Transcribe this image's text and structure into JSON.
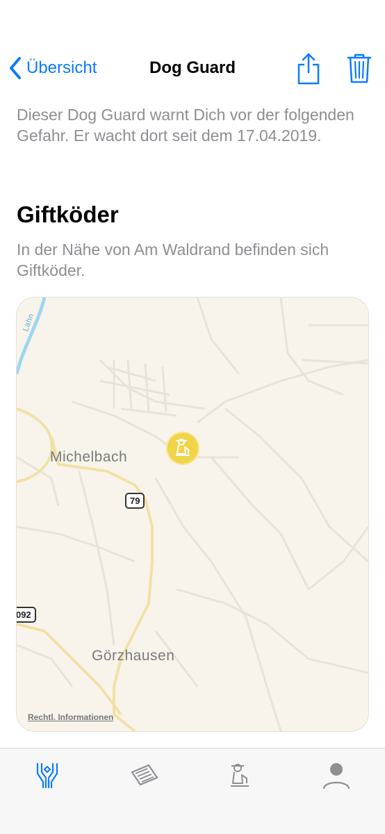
{
  "navbar": {
    "back_label": "Übersicht",
    "title": "Dog Guard",
    "share_icon": "share-icon",
    "trash_icon": "trash-icon"
  },
  "intro_text": "Dieser Dog Guard warnt Dich vor der folgenden Gefahr. Er wacht dort seit dem 17.04.2019.",
  "danger": {
    "title": "Giftköder",
    "description": "In der Nähe von Am Waldrand befinden sich Giftköder."
  },
  "map": {
    "places": [
      "Michelbach",
      "Görzhausen"
    ],
    "river_label": "Lahn",
    "road_numbers": [
      "79",
      "092"
    ],
    "legal_label": "Rechtl. Informationen",
    "pin_icon": "dog-guard-pin-icon"
  },
  "tabbar": {
    "items": [
      "hands-icon",
      "newspaper-icon",
      "dog-icon",
      "profile-icon"
    ],
    "active_color": "#0a7aff",
    "inactive_color": "#8e8e93"
  },
  "colors": {
    "accent": "#0a7aff",
    "pin": "#f0d54a",
    "map_bg": "#f8f4ec"
  }
}
